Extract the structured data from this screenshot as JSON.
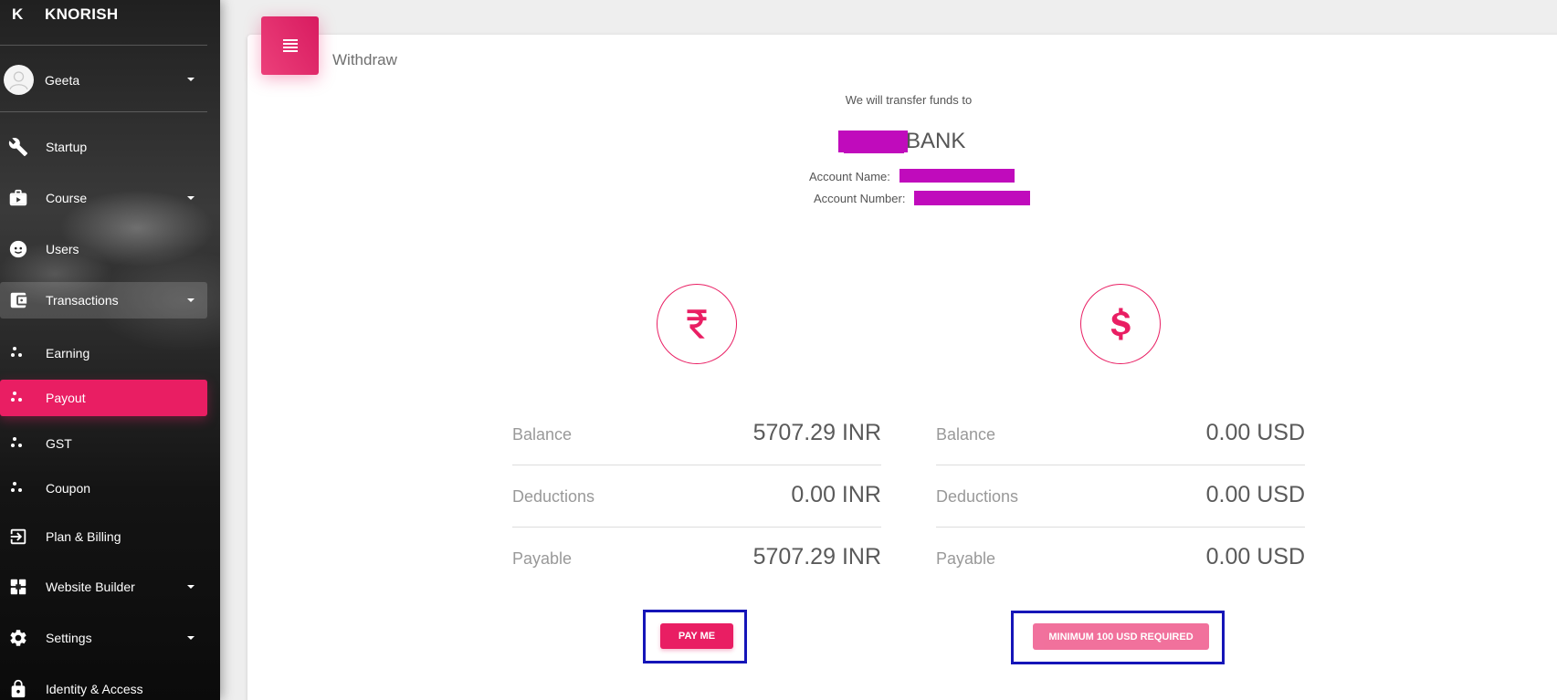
{
  "sidebar": {
    "brand_mini": "K",
    "brand_name": "KNORISH",
    "user_name": "Geeta",
    "items": [
      {
        "label": "Startup",
        "icon": "wrench-icon"
      },
      {
        "label": "Course",
        "icon": "briefcase-icon"
      },
      {
        "label": "Users",
        "icon": "face-icon"
      },
      {
        "label": "Transactions",
        "icon": "wallet-icon"
      },
      {
        "label": "Earning",
        "icon": "dots-icon"
      },
      {
        "label": "Payout",
        "icon": "dots-icon"
      },
      {
        "label": "GST",
        "icon": "dots-icon"
      },
      {
        "label": "Coupon",
        "icon": "dots-icon"
      },
      {
        "label": "Plan & Billing",
        "icon": "exit-to-app-icon"
      },
      {
        "label": "Website Builder",
        "icon": "widgets-icon"
      },
      {
        "label": "Settings",
        "icon": "gear-icon"
      },
      {
        "label": "Identity & Access",
        "icon": "lock-icon"
      }
    ]
  },
  "main": {
    "title": "Withdraw",
    "transfer_text": "We will transfer funds to",
    "bank_suffix": "BANK",
    "account_name_label": "Account Name:",
    "account_number_label": "Account Number:",
    "inr": {
      "icon": "rupee-icon",
      "balance_label": "Balance",
      "balance_value": "5707.29 INR",
      "deductions_label": "Deductions",
      "deductions_value": "0.00 INR",
      "payable_label": "Payable",
      "payable_value": "5707.29 INR",
      "button_label": "PAY ME"
    },
    "usd": {
      "icon": "dollar-icon",
      "balance_label": "Balance",
      "balance_value": "0.00 USD",
      "deductions_label": "Deductions",
      "deductions_value": "0.00 USD",
      "payable_label": "Payable",
      "payable_value": "0.00 USD",
      "button_label": "MINIMUM 100 USD REQUIRED"
    }
  },
  "colors": {
    "accent": "#e91e63",
    "highlight_box": "#1515b8",
    "redaction": "#c00bbc"
  }
}
